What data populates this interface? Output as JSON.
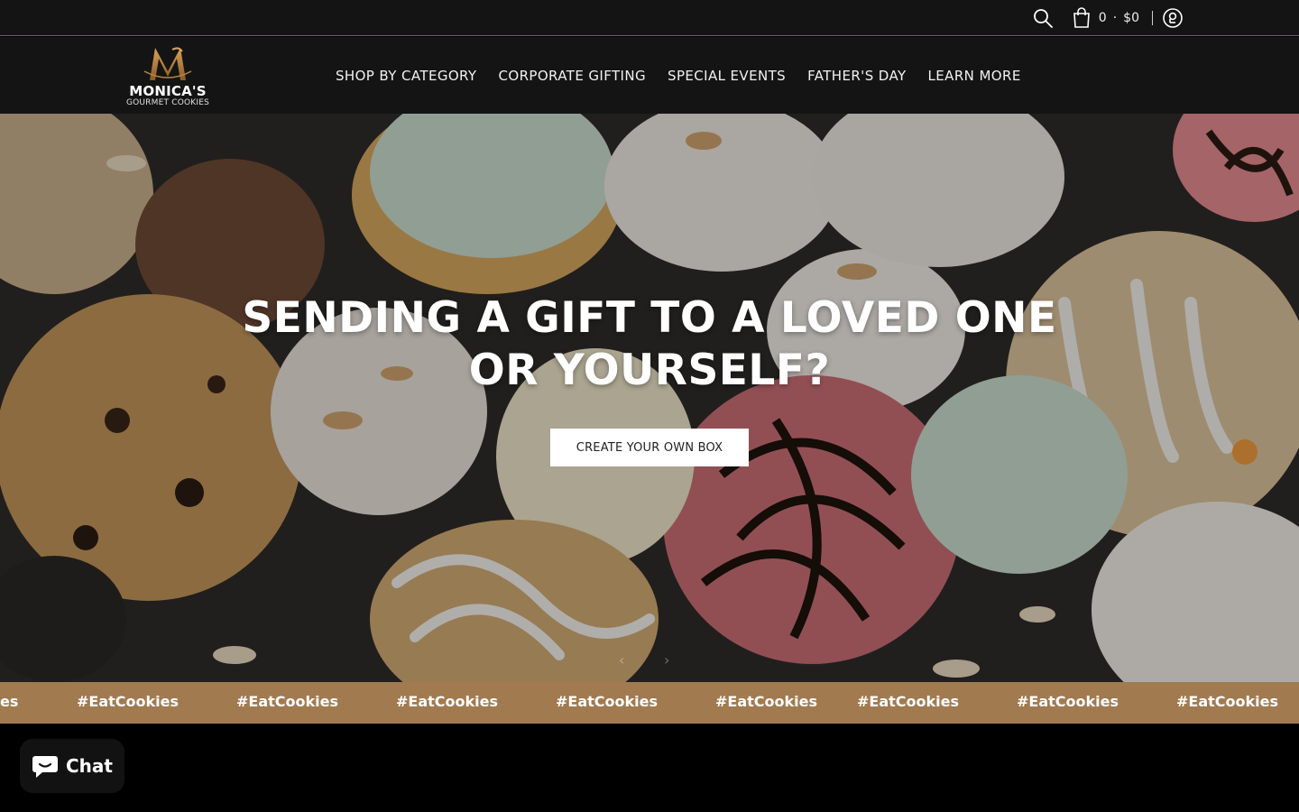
{
  "utility_bar": {
    "cart_count": "0",
    "cart_separator": "·",
    "cart_total": "$0",
    "icons": [
      "search-icon",
      "cart-icon",
      "account-icon"
    ]
  },
  "header": {
    "logo": {
      "name": "MONICA'S",
      "tagline": "GOURMET COOKIES"
    },
    "nav": [
      {
        "label": "SHOP BY CATEGORY"
      },
      {
        "label": "CORPORATE GIFTING"
      },
      {
        "label": "SPECIAL EVENTS"
      },
      {
        "label": "FATHER'S DAY"
      },
      {
        "label": "LEARN MORE"
      }
    ]
  },
  "hero": {
    "heading_line1": "SENDING A GIFT TO A LOVED ONE",
    "heading_line2": "OR YOURSELF?",
    "cta_label": "CREATE YOUR OWN BOX",
    "prev_arrow": "‹",
    "next_arrow": "›"
  },
  "marquee": {
    "items": [
      "es",
      "#EatCookies",
      "#EatCookies",
      "#EatCookies",
      "#EatCookies",
      "#EatCookies",
      "#EatCookies",
      "#EatCookies",
      "#EatCookies"
    ],
    "background": "#a27a50"
  },
  "chat": {
    "label": "Chat"
  },
  "colors": {
    "header_bg": "#141414",
    "accent_gold": "#a27a50",
    "header_border": "#7a6346"
  }
}
